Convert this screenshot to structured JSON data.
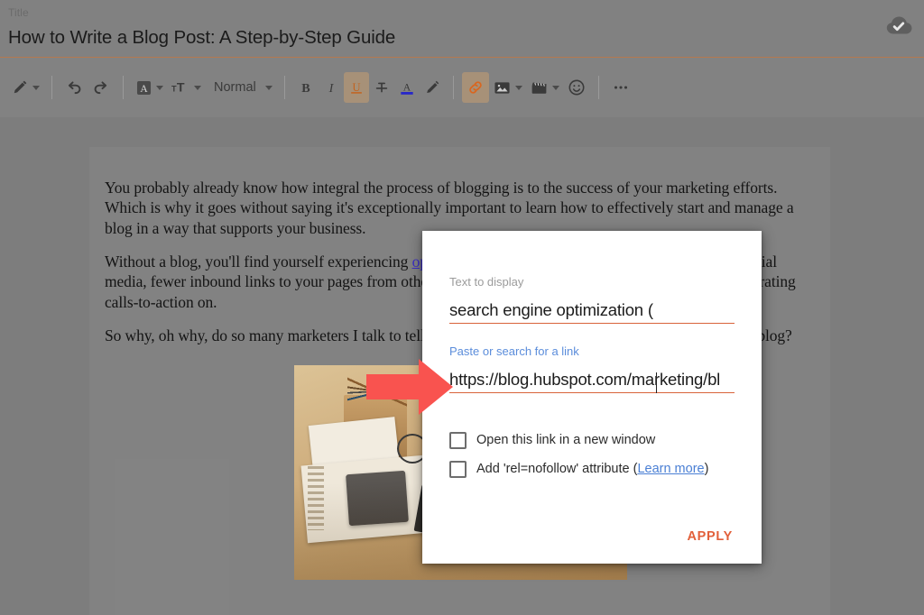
{
  "header": {
    "title_label": "Title",
    "doc_title": "How to Write a Blog Post: A Step-by-Step Guide",
    "save_icon": "cloud-check-icon"
  },
  "toolbar": {
    "items": [
      {
        "name": "pen-tool",
        "icon": "pencil-icon",
        "label": "",
        "caret": true,
        "active": false
      },
      {
        "name": "undo",
        "icon": "undo-icon",
        "label": "",
        "caret": false,
        "active": false
      },
      {
        "name": "redo",
        "icon": "redo-icon",
        "label": "",
        "caret": false,
        "active": false
      },
      {
        "name": "font-family",
        "icon": "font-a-box-icon",
        "label": "",
        "caret": true,
        "active": false
      },
      {
        "name": "font-size",
        "icon": "text-size-icon",
        "label": "",
        "caret": true,
        "active": false
      },
      {
        "name": "paragraph-style",
        "icon": "",
        "label": "Normal",
        "caret": true,
        "active": false
      },
      {
        "name": "bold",
        "icon": "bold-icon",
        "label": "",
        "caret": false,
        "active": false
      },
      {
        "name": "italic",
        "icon": "italic-icon",
        "label": "",
        "caret": false,
        "active": false
      },
      {
        "name": "underline",
        "icon": "underline-icon",
        "label": "",
        "caret": false,
        "active": true
      },
      {
        "name": "strikethrough",
        "icon": "strikethrough-icon",
        "label": "",
        "caret": false,
        "active": false
      },
      {
        "name": "text-color",
        "icon": "text-color-icon",
        "label": "",
        "caret": false,
        "active": false
      },
      {
        "name": "highlight",
        "icon": "marker-pen-icon",
        "label": "",
        "caret": false,
        "active": false
      },
      {
        "name": "insert-link",
        "icon": "link-icon",
        "label": "",
        "caret": false,
        "active": true
      },
      {
        "name": "insert-image",
        "icon": "image-icon",
        "label": "",
        "caret": true,
        "active": false
      },
      {
        "name": "insert-video",
        "icon": "clapper-icon",
        "label": "",
        "caret": true,
        "active": false
      },
      {
        "name": "insert-emoji",
        "icon": "emoji-icon",
        "label": "",
        "caret": false,
        "active": false
      },
      {
        "name": "more-options",
        "icon": "ellipsis-icon",
        "label": "",
        "caret": false,
        "active": false
      }
    ],
    "paragraph_style_value": "Normal",
    "accent_orange": "#e2603a",
    "underline_swatch": "#2727c9"
  },
  "document": {
    "paragraph_1": "You probably already know how integral the process of blogging is to the success of your marketing efforts. Which is why it goes without saying it's exceptionally important to learn how to effectively start and manage a blog in a way that supports your business.",
    "paragraph_2_before": "Without a blog, you'll find yourself experiencing ",
    "paragraph_2_link": "optimization (SEO)",
    "paragraph_2_after": ", lack of promotional content for social media, fewer inbound links to your pages from other publishers, and fewer pages to share your lead-generating calls-to-action on.",
    "paragraph_3": "So why, oh why, do so many marketers I talk to tell me that they don't blog, or that they don't maintain a blog?",
    "image_alt": "desk-photo-with-laptop-pencils-notebook"
  },
  "link_dialog": {
    "text_label": "Text to display",
    "text_value": "search engine optimization (",
    "url_label": "Paste or search for a link",
    "url_value": "https://blog.hubspot.com/marketing/bl",
    "checkbox_new_window": {
      "label": "Open this link in a new window",
      "checked": false
    },
    "checkbox_nofollow": {
      "label_before": "Add 'rel=nofollow' attribute (",
      "link_text": "Learn more",
      "label_after": ")",
      "checked": false
    },
    "apply_label": "APPLY",
    "underline_color": "#d9633a",
    "link_color": "#4a7fd4"
  },
  "annotation": {
    "arrow": "red-right-arrow",
    "arrow_color": "#f9534f"
  }
}
